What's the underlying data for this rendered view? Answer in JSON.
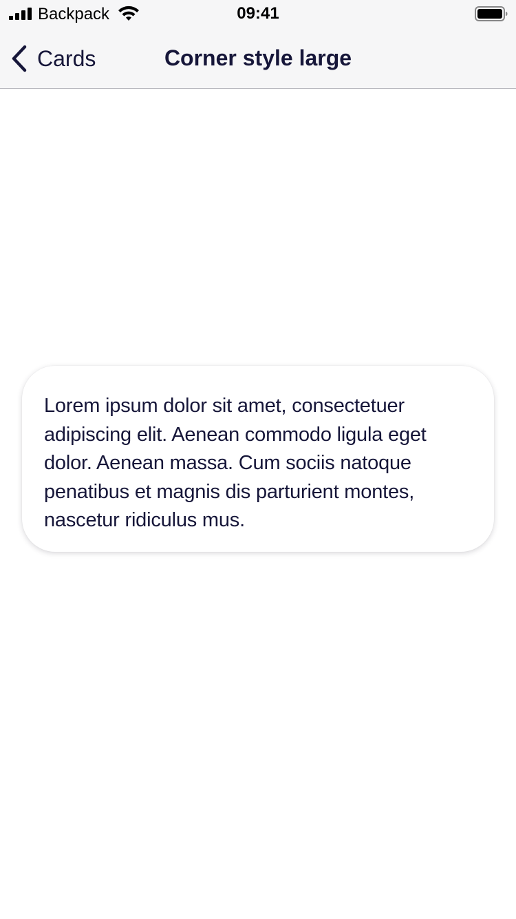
{
  "status_bar": {
    "carrier": "Backpack",
    "time": "09:41",
    "icons": [
      "signal-icon",
      "wifi-icon",
      "battery-icon"
    ]
  },
  "nav": {
    "back_label": "Cards",
    "back_icon": "chevron-left-icon",
    "title": "Corner style large"
  },
  "card": {
    "text": "Lorem ipsum dolor sit amet, consectetuer adipiscing elit. Aenean commodo ligula eget dolor. Aenean massa. Cum sociis natoque penatibus et magnis dis parturient montes, nascetur ridiculus mus."
  },
  "colors": {
    "text_primary": "#161639",
    "nav_background": "#f6f6f7",
    "page_background": "#ffffff"
  }
}
